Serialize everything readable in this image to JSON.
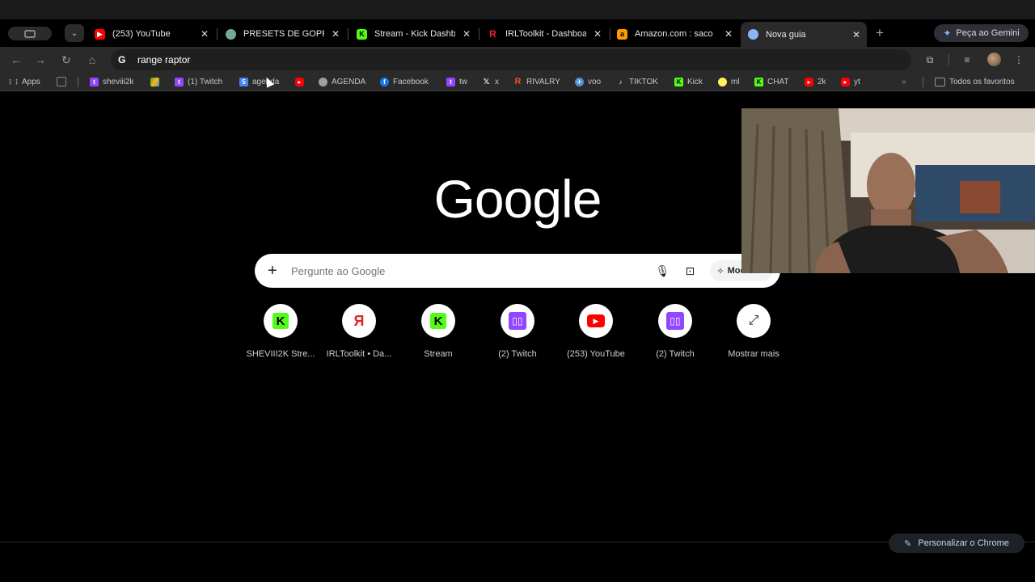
{
  "tabs": [
    {
      "title": "(253) YouTube",
      "favicon": "youtube-icon",
      "color": "#ff0000",
      "active": false
    },
    {
      "title": "PRESETS DE GOPRO",
      "favicon": "chatgpt-icon",
      "color": "#74aa9c",
      "active": false
    },
    {
      "title": "Stream - Kick Dashboard",
      "favicon": "kick-icon",
      "color": "#53fc18",
      "active": false
    },
    {
      "title": "IRLToolkit - Dashboard",
      "favicon": "irltoolkit-icon",
      "color": "#e2242b",
      "active": false
    },
    {
      "title": "Amazon.com : saco",
      "favicon": "amazon-icon",
      "color": "#ff9900",
      "active": false
    },
    {
      "title": "Nova guia",
      "favicon": "chrome-icon",
      "color": "#8ab4f8",
      "active": true
    }
  ],
  "gemini_button": "Peça ao Gemini",
  "omnibox": {
    "text": "range raptor"
  },
  "bookmarks": [
    {
      "label": "Apps",
      "icon": "apps-grid-icon",
      "color": "#8ab4f8"
    },
    {
      "label": "",
      "icon": "tab-groups-icon",
      "color": "#888888"
    },
    {
      "label": "sheviii2k",
      "icon": "twitch-icon",
      "color": "#9146ff"
    },
    {
      "label": "",
      "icon": "google-drive-icon",
      "color": "#34a853"
    },
    {
      "label": "(1) Twitch",
      "icon": "twitch-icon",
      "color": "#9146ff"
    },
    {
      "label": "agenda",
      "icon": "calendar-icon",
      "color": "#4285f4"
    },
    {
      "label": "",
      "icon": "youtube-icon",
      "color": "#ff0000"
    },
    {
      "label": "AGENDA",
      "icon": "globe-icon",
      "color": "#9aa0a6"
    },
    {
      "label": "Facebook",
      "icon": "facebook-icon",
      "color": "#1877f2"
    },
    {
      "label": "tw",
      "icon": "twitch-icon",
      "color": "#9146ff"
    },
    {
      "label": "x",
      "icon": "x-icon",
      "color": "#ffffff"
    },
    {
      "label": "RIVALRY",
      "icon": "rivalry-icon",
      "color": "#e8502a"
    },
    {
      "label": "voo",
      "icon": "voo-icon",
      "color": "#4a90d9"
    },
    {
      "label": "TIKTOK",
      "icon": "tiktok-icon",
      "color": "#ffffff"
    },
    {
      "label": "Kick",
      "icon": "kick-icon",
      "color": "#53fc18"
    },
    {
      "label": "ml",
      "icon": "mercadolivre-icon",
      "color": "#fff159"
    },
    {
      "label": "CHAT",
      "icon": "kick-icon",
      "color": "#53fc18"
    },
    {
      "label": "2k",
      "icon": "youtube-icon",
      "color": "#ff0000"
    },
    {
      "label": "yt",
      "icon": "youtube-icon",
      "color": "#ff0000"
    }
  ],
  "all_bookmarks": "Todos os favoritos",
  "logo": "Google",
  "search": {
    "placeholder": "Pergunte ao Google",
    "ai_mode": "Modo IA"
  },
  "shortcuts": [
    {
      "label": "SHEVIII2K Stre...",
      "icon": "kick-icon"
    },
    {
      "label": "IRLToolkit • Da...",
      "icon": "irltoolkit-icon"
    },
    {
      "label": "Stream",
      "icon": "kick-icon"
    },
    {
      "label": "(2) Twitch",
      "icon": "twitch-icon"
    },
    {
      "label": "(253) YouTube",
      "icon": "youtube-icon"
    },
    {
      "label": "(2) Twitch",
      "icon": "twitch-icon"
    },
    {
      "label": "Mostrar mais",
      "icon": "expand-icon"
    }
  ],
  "customize_button": "Personalizar o Chrome"
}
